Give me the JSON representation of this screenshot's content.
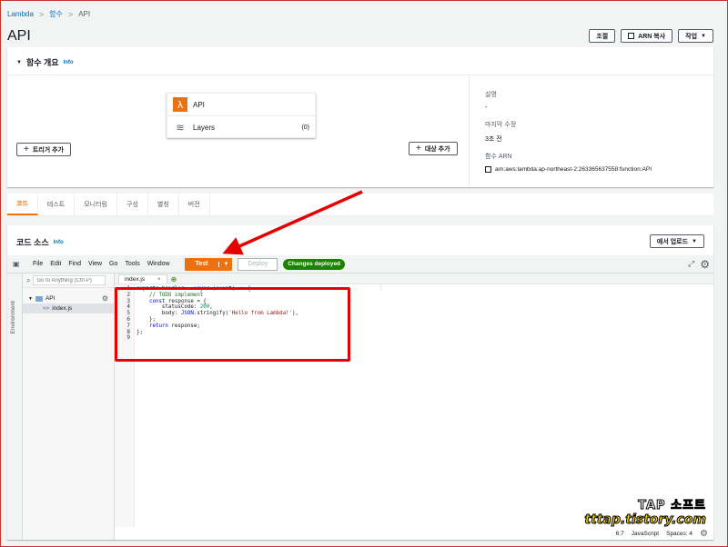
{
  "breadcrumb": {
    "items": [
      "Lambda",
      "함수"
    ],
    "current": "API",
    "separator": ">"
  },
  "page": {
    "title": "API"
  },
  "header_actions": {
    "adjust": "조절",
    "copy_arn": "ARN 복사",
    "actions": "작업"
  },
  "overview": {
    "title": "함수 개요",
    "info": "Info",
    "function_name": "API",
    "layers_label": "Layers",
    "layers_count": "(0)",
    "add_trigger": "트리거 추가",
    "add_destination": "대상 추가",
    "description_label": "설명",
    "description_value": "-",
    "modified_label": "마지막 수정",
    "modified_value": "3초 전",
    "arn_label": "함수 ARN",
    "arn_value": "arn:aws:lambda:ap-northeast-2:263365637558:function:API"
  },
  "tabs": [
    {
      "label": "코드",
      "active": true
    },
    {
      "label": "테스트",
      "active": false
    },
    {
      "label": "모니터링",
      "active": false
    },
    {
      "label": "구성",
      "active": false
    },
    {
      "label": "별칭",
      "active": false
    },
    {
      "label": "버전",
      "active": false
    }
  ],
  "code_source": {
    "title": "코드 소스",
    "info": "Info",
    "upload": "에서 업로드",
    "menu": [
      "File",
      "Edit",
      "Find",
      "View",
      "Go",
      "Tools",
      "Window"
    ],
    "test": "Test",
    "deploy": "Deploy",
    "deployed": "Changes deployed",
    "search_placeholder": "Go to Anything (Ctrl-P)",
    "environment": "Environment",
    "folder": "API",
    "file": "index.js",
    "open_tab": "index.js",
    "line_numbers": [
      "1",
      "2",
      "3",
      "4",
      "5",
      "6",
      "7",
      "8",
      "9"
    ],
    "status": {
      "position": "6:7",
      "language": "JavaScript",
      "spaces": "Spaces: 4"
    }
  },
  "watermark": {
    "top": "TAP 소프트",
    "bottom": "tttap.tistory.com"
  },
  "colors": {
    "accent": "#ec7211",
    "link": "#0073bb",
    "success": "#1d8102",
    "annotation": "#e60000"
  }
}
